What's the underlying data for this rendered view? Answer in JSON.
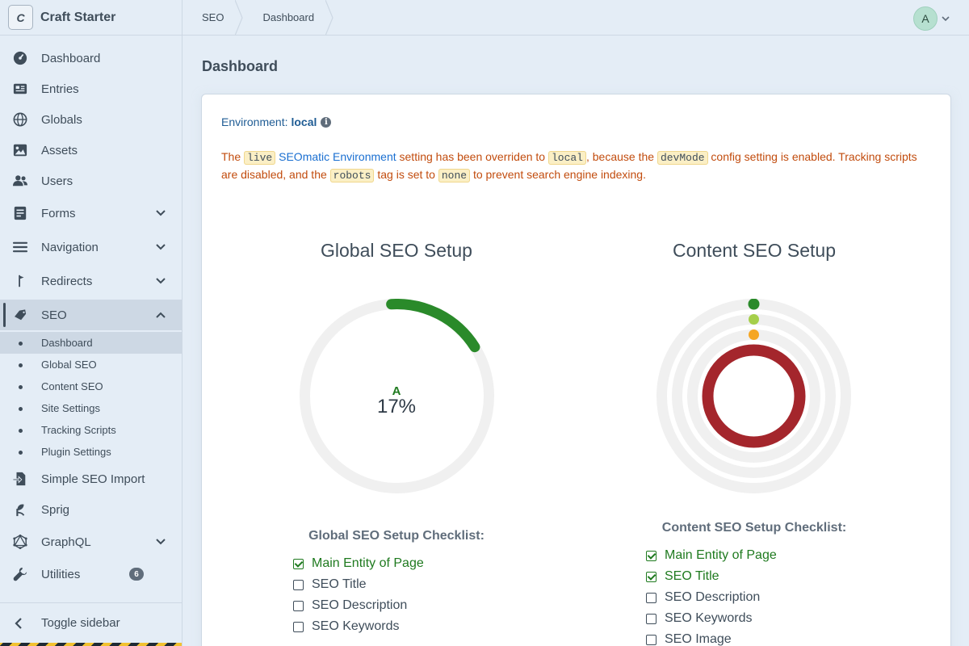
{
  "site": {
    "logo_letter": "C",
    "name": "Craft Starter"
  },
  "nav": {
    "items": [
      {
        "label": "Dashboard",
        "icon": "gauge-icon"
      },
      {
        "label": "Entries",
        "icon": "newspaper-icon"
      },
      {
        "label": "Globals",
        "icon": "globe-icon"
      },
      {
        "label": "Assets",
        "icon": "image-icon"
      },
      {
        "label": "Users",
        "icon": "users-icon"
      },
      {
        "label": "Forms",
        "icon": "form-icon"
      },
      {
        "label": "Navigation",
        "icon": "bars-icon"
      },
      {
        "label": "Redirects",
        "icon": "signpost-icon"
      },
      {
        "label": "SEO",
        "icon": "seo-tag-icon"
      },
      {
        "label": "Simple SEO Import",
        "icon": "file-import-icon"
      },
      {
        "label": "Sprig",
        "icon": "sprig-icon"
      },
      {
        "label": "GraphQL",
        "icon": "graphql-icon"
      },
      {
        "label": "Utilities",
        "icon": "wrench-icon",
        "badge": "6"
      }
    ],
    "seo_subitems": [
      "Dashboard",
      "Global SEO",
      "Content SEO",
      "Site Settings",
      "Tracking Scripts",
      "Plugin Settings"
    ],
    "toggle_label": "Toggle sidebar"
  },
  "breadcrumbs": [
    "SEO",
    "Dashboard"
  ],
  "user": {
    "initial": "A"
  },
  "page": {
    "title": "Dashboard"
  },
  "environment": {
    "label": "Environment:",
    "value": "local"
  },
  "warning": {
    "t1": "The ",
    "c1": "live",
    "link": "SEOmatic Environment",
    "t2": " setting has been overriden to ",
    "c2": "local",
    "t3": ", because the ",
    "c3": "devMode",
    "t4": " config setting is enabled. Tracking scripts are disabled, and the ",
    "c4": "robots",
    "t5": " tag is set to ",
    "c5": "none",
    "t6": " to prevent search engine indexing."
  },
  "global_seo": {
    "title": "Global SEO Setup",
    "grade": "A",
    "percent_label": "17%",
    "percent": 17,
    "checklist_title": "Global SEO Setup Checklist:",
    "checklist": [
      {
        "label": "Main Entity of Page",
        "checked": true
      },
      {
        "label": "SEO Title",
        "checked": false
      },
      {
        "label": "SEO Description",
        "checked": false
      },
      {
        "label": "SEO Keywords",
        "checked": false
      }
    ]
  },
  "content_seo": {
    "title": "Content SEO Setup",
    "checklist_title": "Content SEO Setup Checklist:",
    "checklist": [
      {
        "label": "Main Entity of Page",
        "checked": true
      },
      {
        "label": "SEO Title",
        "checked": true
      },
      {
        "label": "SEO Description",
        "checked": false
      },
      {
        "label": "SEO Keywords",
        "checked": false
      },
      {
        "label": "SEO Image",
        "checked": false
      }
    ]
  },
  "colors": {
    "good": "#2a8a2a",
    "ok": "#a5cf4a",
    "warn": "#f5a623",
    "bad": "#a4262c",
    "track": "#f0f0f0"
  }
}
